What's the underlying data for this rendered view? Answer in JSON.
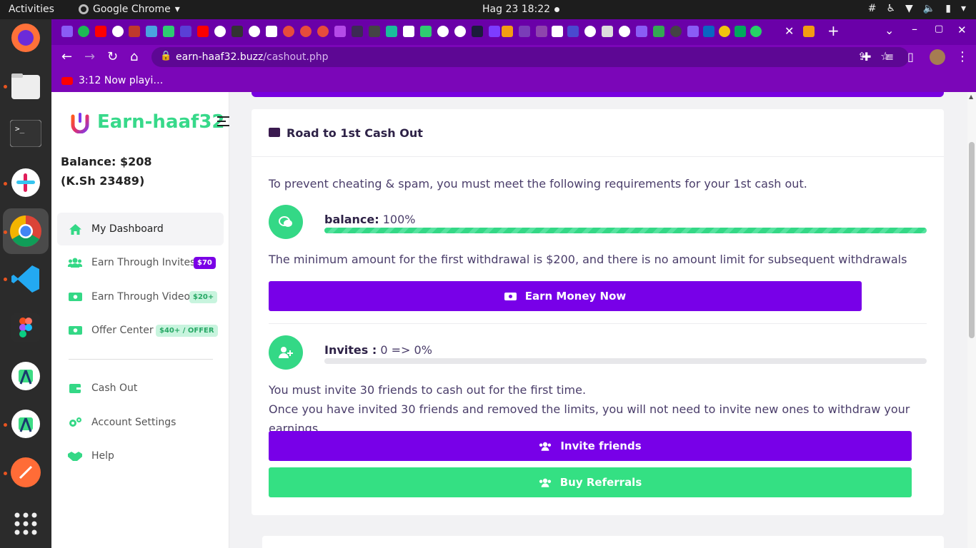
{
  "system": {
    "activities": "Activities",
    "app_name": "Google Chrome",
    "datetime": "Hag 23  18:22"
  },
  "browser": {
    "url_host": "earn-haaf32.buzz",
    "url_path": "/cashout.php",
    "bookmark_label": "3:12 Now playi…",
    "accent_color": "#7b06b8"
  },
  "sidebar": {
    "brand_name": "Earn-haaf32",
    "balance_line1": "Balance: $208",
    "balance_line2": "(K.Sh 23489)",
    "items": [
      {
        "label": "My Dashboard",
        "icon": "home-icon"
      },
      {
        "label": "Earn Through Invites",
        "icon": "users-icon",
        "badge": "$70"
      },
      {
        "label": "Earn Through Video",
        "icon": "money-icon",
        "badge": "$20+"
      },
      {
        "label": "Offer Center",
        "icon": "money-icon",
        "badge": "$40+ / OFFER"
      },
      {
        "label": "Cash Out",
        "icon": "wallet-icon"
      },
      {
        "label": "Account Settings",
        "icon": "cogs-icon"
      },
      {
        "label": "Help",
        "icon": "handshake-icon"
      }
    ]
  },
  "main": {
    "card_title": "Road to 1st Cash Out",
    "intro": "To prevent cheating & spam, you must meet the following requirements for your 1st cash out.",
    "requirements": [
      {
        "label": "balance:",
        "value": "100%",
        "progress": 1.0,
        "note": "The minimum amount for the first withdrawal is $200, and there is no amount limit for subsequent withdrawals",
        "button": "Earn Money Now"
      },
      {
        "label": "Invites :",
        "value": "0 => 0%",
        "progress": 0.0,
        "note1": "You must invite 30 friends to cash out for the first time.",
        "note2": "Once you have invited 30 friends and removed the limits, you will not need to invite new ones to withdraw your earnings.",
        "button": "Invite friends",
        "button2": "Buy Referrals"
      }
    ]
  }
}
